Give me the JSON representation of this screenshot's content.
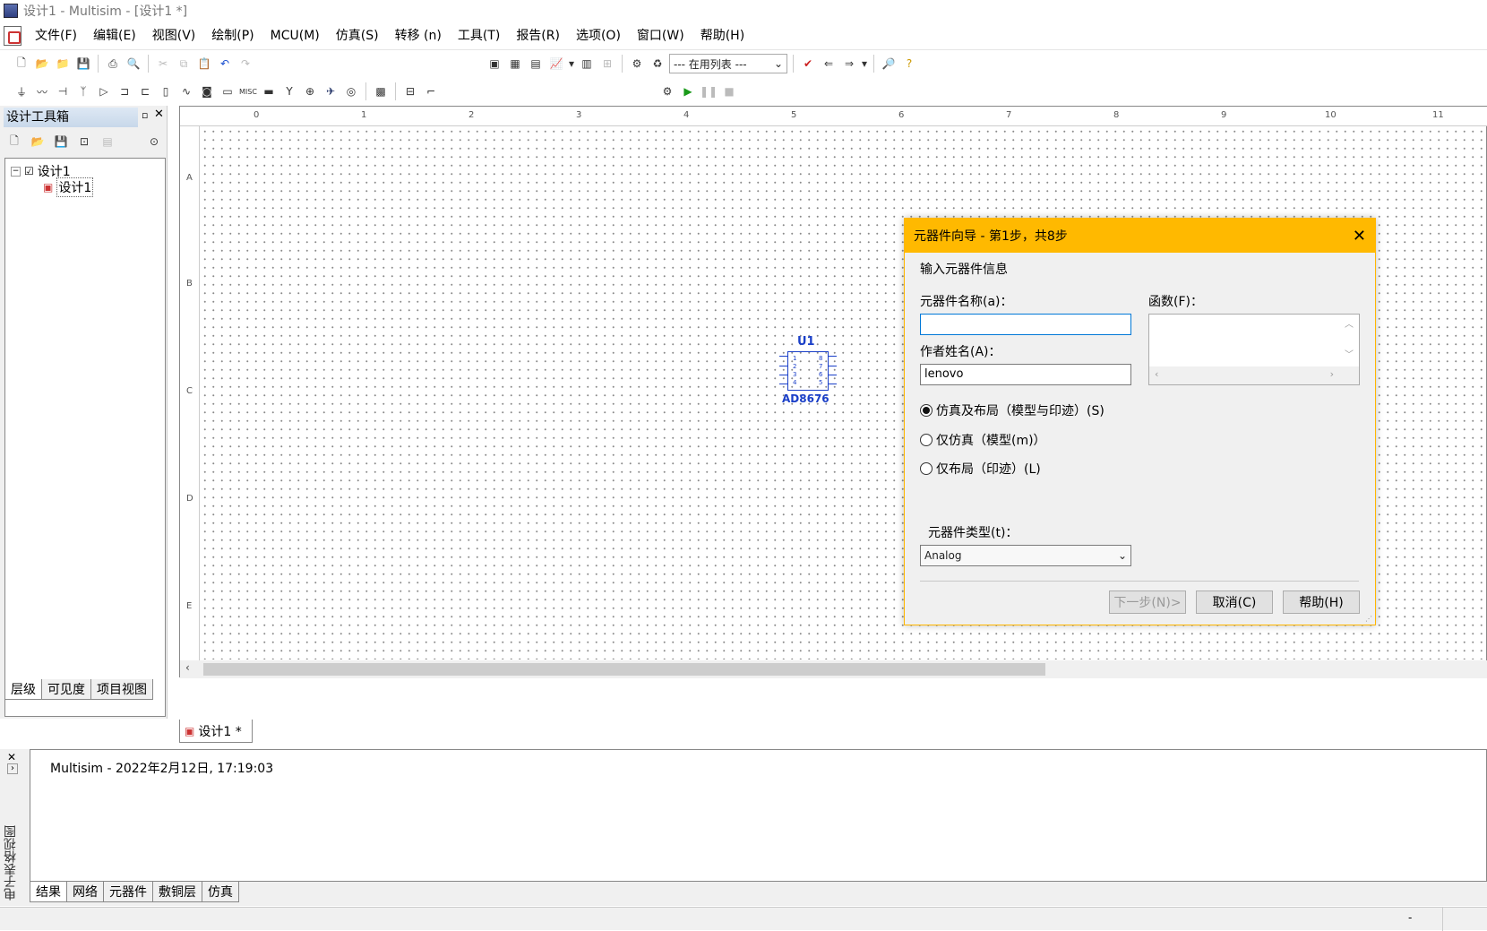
{
  "window": {
    "title": "设计1 - Multisim - [设计1 *]"
  },
  "menu": [
    "文件(F)",
    "编辑(E)",
    "视图(V)",
    "绘制(P)",
    "MCU(M)",
    "仿真(S)",
    "转移 (n)",
    "工具(T)",
    "报告(R)",
    "选项(O)",
    "窗口(W)",
    "帮助(H)"
  ],
  "toolbar": {
    "inuse_list": "--- 在用列表 ---"
  },
  "design_toolbox": {
    "title": "设计工具箱",
    "tree_root": "设计1",
    "tree_child": "设计1",
    "tabs": [
      "层级",
      "可见度",
      "项目视图"
    ]
  },
  "ruler": {
    "columns": [
      "0",
      "1",
      "2",
      "3",
      "4",
      "5",
      "6",
      "7",
      "8",
      "9",
      "10",
      "11"
    ],
    "rows": [
      "A",
      "B",
      "C",
      "D",
      "E"
    ]
  },
  "component": {
    "ref": "U1",
    "name": "AD8676",
    "left_pins": [
      "1",
      "2",
      "3",
      "4"
    ],
    "right_pins": [
      "8",
      "7",
      "6",
      "5"
    ]
  },
  "document_tab": "设计1 *",
  "output": {
    "message": "Multisim  -  2022年2月12日, 17:19:03",
    "side_label": "电子表格视图",
    "tabs": [
      "结果",
      "网络",
      "元器件",
      "敷铜层",
      "仿真"
    ]
  },
  "dialog": {
    "title": "元器件向导 - 第1步，共8步",
    "section": "输入元器件信息",
    "name_label": "元器件名称(a)：",
    "name_value": "",
    "author_label": "作者姓名(A)：",
    "author_value": "lenovo",
    "function_label": "函数(F)：",
    "options": [
      "仿真及布局（模型与印迹）(S)",
      "仅仿真（模型(m)）",
      "仅布局（印迹）(L)"
    ],
    "selected_option": 0,
    "type_label": "元器件类型(t)：",
    "type_value": "Analog",
    "next_button": "下一步(N)>",
    "cancel_button": "取消(C)",
    "help_button": "帮助(H)"
  },
  "status": {
    "right_text": "-"
  }
}
